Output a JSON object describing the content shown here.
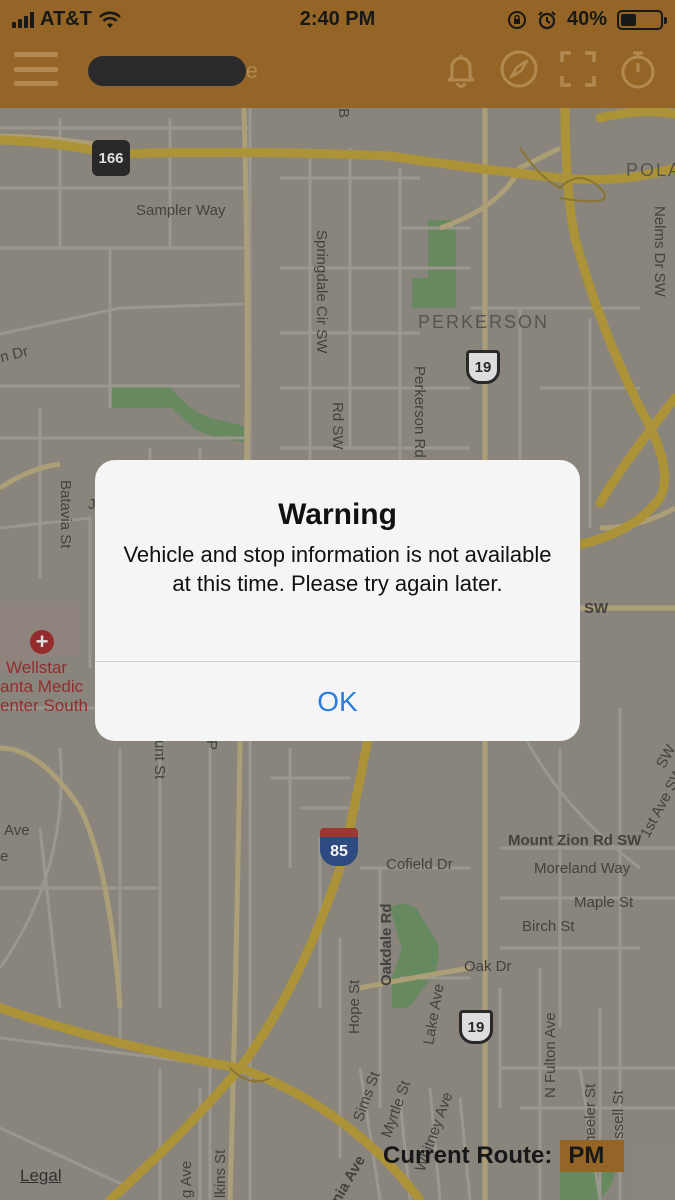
{
  "status_bar": {
    "carrier": "AT&T",
    "time": "2:40 PM",
    "battery_percent": "40%",
    "battery_level": 0.4
  },
  "nav_bar": {
    "title_visible_fragment": "e",
    "icons": [
      "menu-icon",
      "bell-icon",
      "compass-icon",
      "fullscreen-icon",
      "timer-icon"
    ]
  },
  "map": {
    "labels": {
      "sampler_way": "Sampler Way",
      "springdale": "Springdale Cir SW",
      "perkerson": "PERKERSON",
      "perkerson_rd": "Perkerson Rd",
      "nelms": "Nelms Dr SW",
      "pola": "POLA",
      "batavia": "Batavia St",
      "n_dr": "n Dr",
      "rd_sw": "Rd SW",
      "b_frag": "B",
      "sw_right": "SW",
      "j_frag": "J",
      "wellstar1": "Wellstar",
      "wellstar2": "anta Medic",
      "wellstar3": "enter South",
      "unt_st": "unt St",
      "p_frag": "P",
      "ave_left": "Ave",
      "e_left": "e",
      "ave_1st": "1st Ave SW",
      "sw_edge": "SW",
      "mount_zion": "Mount Zion Rd SW",
      "moreland": "Moreland Way",
      "maple": "Maple St",
      "birch": "Birch St",
      "cofield": "Cofield Dr",
      "oakdale": "Oakdale Rd",
      "hope": "Hope St",
      "lake": "Lake Ave",
      "oak_dr": "Oak Dr",
      "n_fulton": "N Fulton Ave",
      "wheeler": "Wheeler St",
      "russell": "Russell St",
      "sims": "Sims St",
      "myrtle": "Myrtle St",
      "whitney": "Whitney Ave",
      "g_ave": "g Ave",
      "lkins": "lkins St",
      "nia_ave": "nia Ave"
    },
    "shields": {
      "route_166": "166",
      "us_19_top": "19",
      "us_19_bottom": "19",
      "i_85": "85"
    }
  },
  "dialog": {
    "title": "Warning",
    "message": "Vehicle and stop information is not available at this time. Please try again later.",
    "ok_label": "OK"
  },
  "footer": {
    "current_route_label": "Current Route:",
    "current_route_value": "PM",
    "legal_label": "Legal"
  },
  "colors": {
    "bar_brown": "#9b6a28",
    "link_blue": "#2d7de0",
    "highway_yellow": "#b59a3a"
  }
}
